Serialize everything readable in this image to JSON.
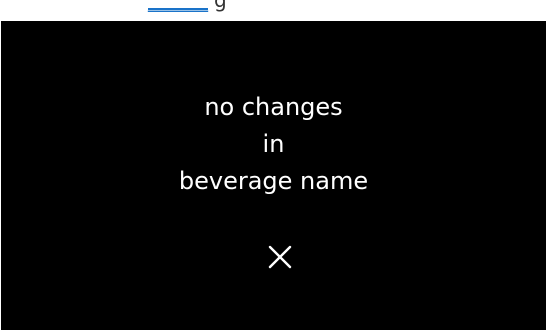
{
  "document_fragment": {
    "link_text": "______",
    "trailing_text": "g"
  },
  "screen": {
    "message_lines": [
      "no changes",
      "in",
      "beverage name"
    ],
    "close_icon": "close-icon",
    "background_color": "#000000",
    "text_color": "#ffffff"
  }
}
